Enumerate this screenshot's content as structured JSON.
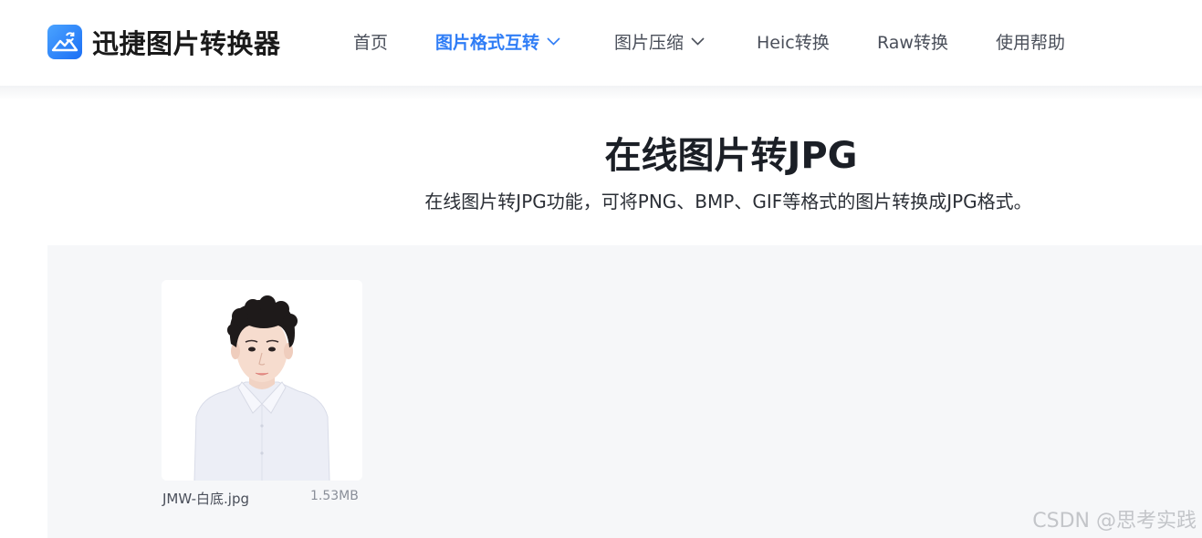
{
  "app": {
    "title": "迅捷图片转换器"
  },
  "nav": {
    "items": [
      {
        "label": "首页",
        "active": false,
        "has_dropdown": false
      },
      {
        "label": "图片格式互转",
        "active": true,
        "has_dropdown": true
      },
      {
        "label": "图片压缩",
        "active": false,
        "has_dropdown": true
      },
      {
        "label": "Heic转换",
        "active": false,
        "has_dropdown": false
      },
      {
        "label": "Raw转换",
        "active": false,
        "has_dropdown": false
      },
      {
        "label": "使用帮助",
        "active": false,
        "has_dropdown": false
      }
    ]
  },
  "main": {
    "title": "在线图片转JPG",
    "subtitle": "在线图片转JPG功能，可将PNG、BMP、GIF等格式的图片转换成JPG格式。"
  },
  "files": [
    {
      "name": "JMW-白底.jpg",
      "size": "1.53MB"
    }
  ],
  "watermark": "CSDN @思考实践",
  "colors": {
    "accent": "#2f7df6",
    "nav_text": "#4a4f5a",
    "title_text": "#1b1f26",
    "work_area_bg": "#f6f7f9"
  },
  "icons": {
    "logo": "image-convert-icon",
    "dropdown": "chevron-down-icon"
  }
}
